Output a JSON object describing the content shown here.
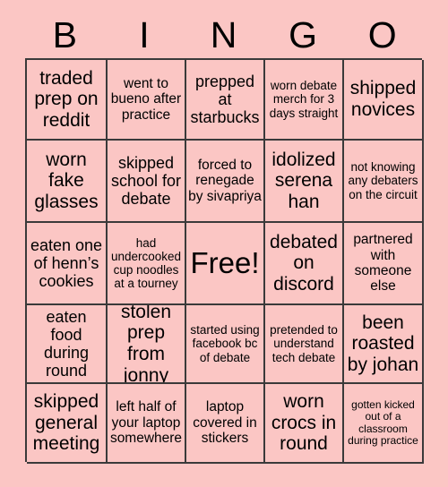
{
  "card": {
    "title_letters": [
      "B",
      "I",
      "N",
      "G",
      "O"
    ],
    "background_color": "#fbc6c4",
    "grid_line_color": "#3a3a3a",
    "text_color": "#000000",
    "rows": 5,
    "columns": 5,
    "cells": [
      {
        "text": "traded prep on reddit",
        "size": "s-lg",
        "free": false
      },
      {
        "text": "went to bueno after practice",
        "size": "s-sm",
        "free": false
      },
      {
        "text": "prepped at starbucks",
        "size": "s-md",
        "free": false
      },
      {
        "text": "worn debate merch for 3 days straight",
        "size": "s-xs",
        "free": false
      },
      {
        "text": "shipped novices",
        "size": "s-lg",
        "free": false
      },
      {
        "text": "worn fake glasses",
        "size": "s-lg",
        "free": false
      },
      {
        "text": "skipped school for debate",
        "size": "s-md",
        "free": false
      },
      {
        "text": "forced to renegade by sivapriya",
        "size": "s-sm",
        "free": false
      },
      {
        "text": "idolized serena han",
        "size": "s-lg",
        "free": false
      },
      {
        "text": "not knowing any debaters on the circuit",
        "size": "s-xs",
        "free": false
      },
      {
        "text": "eaten one of henn’s cookies",
        "size": "s-md",
        "free": false
      },
      {
        "text": "had undercooked cup noodles at a tourney",
        "size": "s-xs",
        "free": false
      },
      {
        "text": "Free!",
        "size": "s-xl",
        "free": true
      },
      {
        "text": "debated on discord",
        "size": "s-lg",
        "free": false
      },
      {
        "text": "partnered with someone else",
        "size": "s-sm",
        "free": false
      },
      {
        "text": "eaten food during round",
        "size": "s-md",
        "free": false
      },
      {
        "text": "stolen prep from jonny",
        "size": "s-lg",
        "free": false
      },
      {
        "text": "started using facebook bc of debate",
        "size": "s-xs",
        "free": false
      },
      {
        "text": "pretended to understand tech debate",
        "size": "s-xs",
        "free": false
      },
      {
        "text": "been roasted by johan",
        "size": "s-lg",
        "free": false
      },
      {
        "text": "skipped general meeting",
        "size": "s-lg",
        "free": false
      },
      {
        "text": "left half of your laptop somewhere",
        "size": "s-sm",
        "free": false
      },
      {
        "text": "laptop covered in stickers",
        "size": "s-sm",
        "free": false
      },
      {
        "text": "worn crocs in round",
        "size": "s-lg",
        "free": false
      },
      {
        "text": "gotten kicked out of a classroom during practice",
        "size": "s-xxs",
        "free": false
      }
    ]
  }
}
